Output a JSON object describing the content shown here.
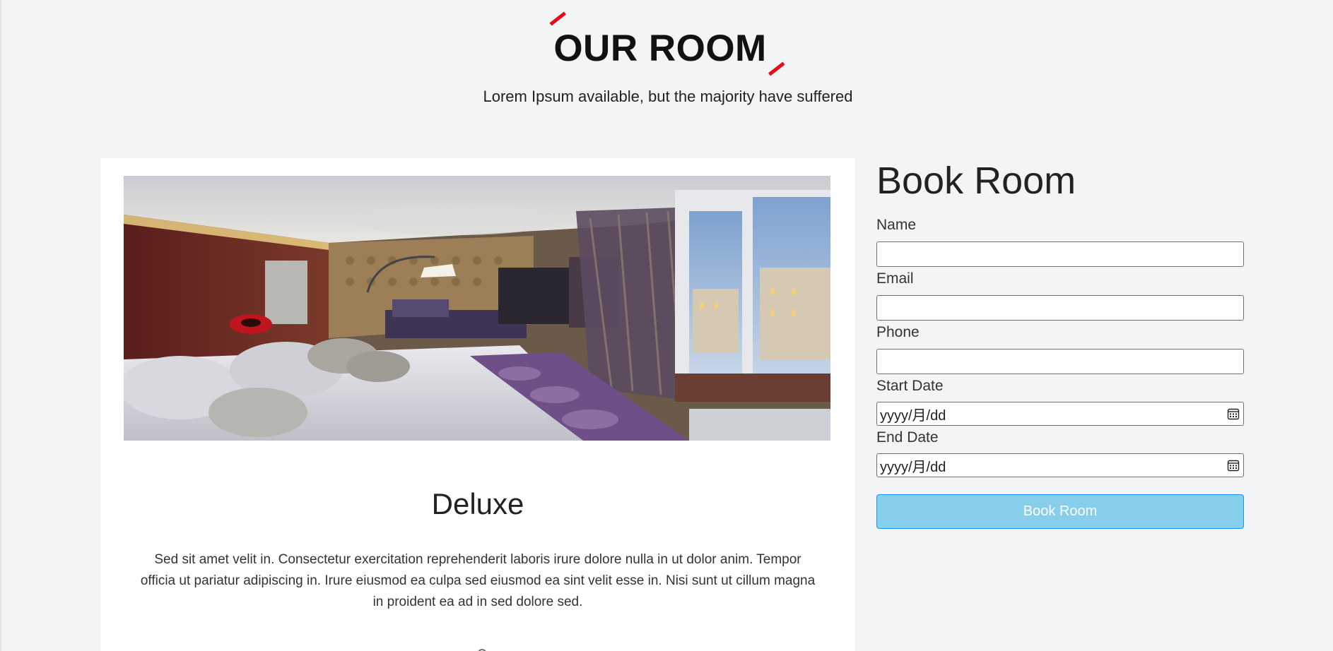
{
  "section": {
    "title": "OUR ROOM",
    "subtitle": "Lorem Ipsum available, but the majority have suffered",
    "accent_color": "#e10d1a"
  },
  "room": {
    "name": "Deluxe",
    "description": "Sed sit amet velit in. Consectetur exercitation reprehenderit laboris irure dolore nulla in ut dolor anim. Tempor officia ut pariatur adipiscing in. Irure eiusmod ea culpa sed eiusmod ea sint velit esse in. Nisi sunt ut cillum magna in proident ea ad in sed dolore sed.",
    "photo_icon": "hotel-room-photo"
  },
  "booking": {
    "title": "Book Room",
    "fields": {
      "name_label": "Name",
      "name_value": "",
      "email_label": "Email",
      "email_value": "",
      "phone_label": "Phone",
      "phone_value": "",
      "start_label": "Start Date",
      "start_value": "yyyy/月/dd",
      "end_label": "End Date",
      "end_value": "yyyy/月/dd"
    },
    "submit_label": "Book Room",
    "button_color": "#87ceeb",
    "button_border": "#1e90ff",
    "calendar_icon": "calendar-icon"
  }
}
